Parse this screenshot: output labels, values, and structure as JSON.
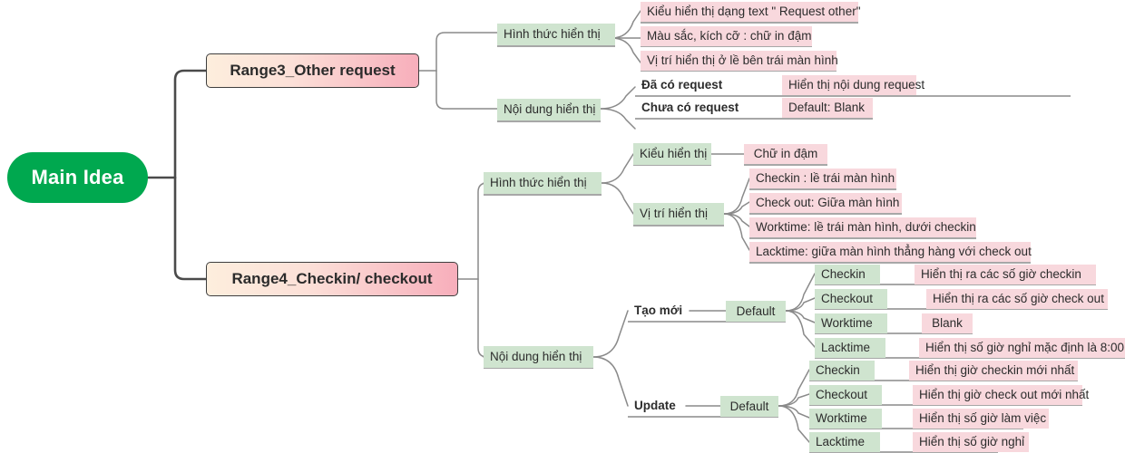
{
  "diagram": {
    "type": "mind-map",
    "title": "Main Idea",
    "colors": {
      "root_fill": "#00a84f",
      "root_text": "#ffffff",
      "branch_gradient_from": "#fdeedd",
      "branch_gradient_to": "#f7aebb",
      "branch_border": "#3e3e3e",
      "chip_green": "#cfe4cf",
      "chip_pink": "#f8d8dd",
      "wire": "#7d7d7d",
      "wire_main": "#4a4a4a",
      "text": "#2c2c2c"
    }
  },
  "root": {
    "label": "Main Idea"
  },
  "branches": [
    {
      "id": "range3",
      "label": "Range3_Other request",
      "children": [
        {
          "label": "Hình thức hiển thị",
          "items": [
            "Kiểu hiển thị dạng text \" Request other\"",
            "Màu sắc, kích cỡ : chữ in đậm",
            "Vị trí hiển thị ở lề bên trái màn hình"
          ]
        },
        {
          "label": "Nội dung hiển thị",
          "rows": [
            {
              "key": "Đã có request",
              "value": "Hiển thị nội dung request"
            },
            {
              "key": "Chưa có request",
              "value": "Default: Blank"
            }
          ]
        }
      ]
    },
    {
      "id": "range4",
      "label": "Range4_Checkin/ checkout",
      "children": [
        {
          "label": "Hình thức hiển thị",
          "groups": [
            {
              "label": "Kiểu hiển thị",
              "items": [
                "Chữ in đậm"
              ]
            },
            {
              "label": "Vị trí hiển thị",
              "items": [
                "Checkin : lề trái màn hình",
                "Check out: Giữa màn hình",
                "Worktime: lề trái màn hình, dưới checkin",
                "Lacktime: giữa màn hình thẳng hàng với check out"
              ]
            }
          ]
        },
        {
          "label": "Nội dung hiển thị",
          "groups": [
            {
              "label": "Tạo mới",
              "mode": "Default",
              "rows": [
                {
                  "key": "Checkin",
                  "value": "Hiển thị ra các số  giờ checkin"
                },
                {
                  "key": "Checkout",
                  "value": "Hiển thị ra các số  giờ check out"
                },
                {
                  "key": "Worktime",
                  "value": "Blank"
                },
                {
                  "key": "Lacktime",
                  "value": "Hiển thị số giờ nghỉ mặc định là 8:00"
                }
              ]
            },
            {
              "label": "Update",
              "mode": "Default",
              "rows": [
                {
                  "key": "Checkin",
                  "value": "Hiển thị giờ checkin mới nhất"
                },
                {
                  "key": "Checkout",
                  "value": "Hiển thị giờ check out mới nhất"
                },
                {
                  "key": "Worktime",
                  "value": "Hiển thị số giờ làm việc"
                },
                {
                  "key": "Lacktime",
                  "value": "Hiển thị số giờ nghỉ"
                }
              ]
            }
          ]
        }
      ]
    }
  ]
}
